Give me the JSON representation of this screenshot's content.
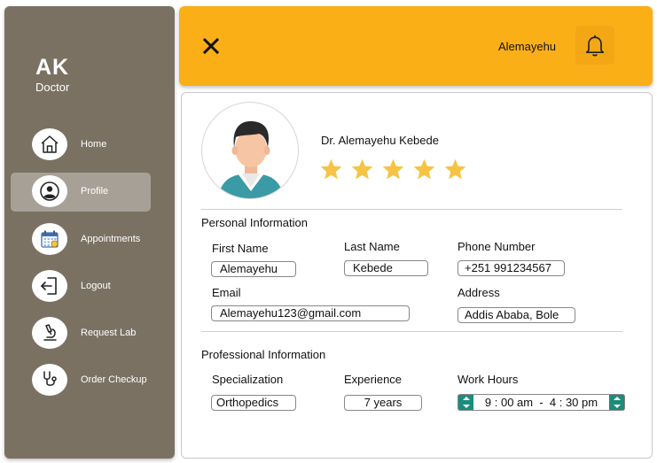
{
  "sidebar": {
    "initials": "AK",
    "role": "Doctor",
    "items": [
      {
        "label": "Home",
        "icon": "home-icon"
      },
      {
        "label": "Profile",
        "icon": "user-icon",
        "active": true
      },
      {
        "label": "Appointments",
        "icon": "calendar-icon"
      },
      {
        "label": "Logout",
        "icon": "logout-icon"
      },
      {
        "label": "Request Lab",
        "icon": "microscope-icon"
      },
      {
        "label": "Order Checkup",
        "icon": "stethoscope-icon"
      }
    ]
  },
  "header": {
    "user_name": "Alemayehu",
    "close_icon": "close-icon",
    "bell_icon": "bell-icon"
  },
  "profile": {
    "full_name": "Dr. Alemayehu Kebede",
    "rating": 5,
    "rating_max": 5
  },
  "personal": {
    "title": "Personal Information",
    "first_name_label": "First Name",
    "first_name": "Alemayehu",
    "last_name_label": "Last Name",
    "last_name": "Kebede",
    "phone_label": "Phone Number",
    "phone": "+251 991234567",
    "email_label": "Email",
    "email": "Alemayehu123@gmail.com",
    "address_label": "Address",
    "address": "Addis Ababa, Bole"
  },
  "professional": {
    "title": "Professional Information",
    "specialization_label": "Specialization",
    "specialization": "Orthopedics",
    "experience_label": "Experience",
    "experience": "7 years",
    "work_hours_label": "Work Hours",
    "work_hours": "9 : 00 am  -  4 : 30 pm"
  },
  "colors": {
    "sidebar_bg": "#7b7163",
    "active_item_bg": "#a7a096",
    "header_bg": "#fbaf17",
    "star": "#f6c344",
    "spinner": "#1c8c7c"
  }
}
